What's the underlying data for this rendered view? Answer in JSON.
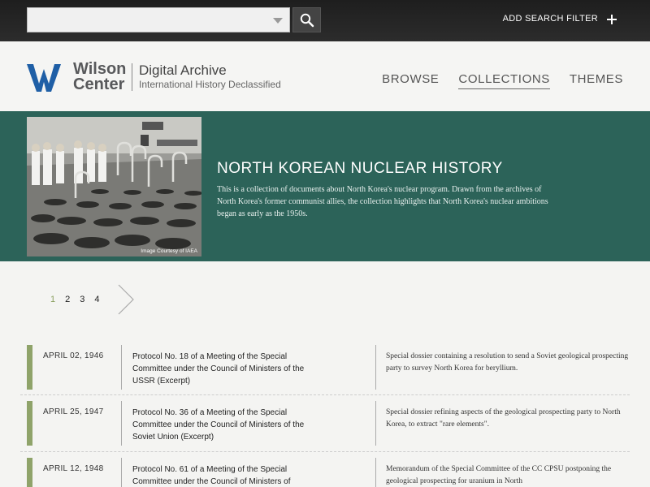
{
  "topbar": {
    "search_placeholder": "",
    "add_filter_label": "ADD SEARCH FILTER"
  },
  "header": {
    "logo_name_line1": "Wilson",
    "logo_name_line2": "Center",
    "site_title": "Digital Archive",
    "site_subtitle": "International History Declassified",
    "nav": [
      {
        "label": "BROWSE"
      },
      {
        "label": "COLLECTIONS"
      },
      {
        "label": "THEMES"
      }
    ]
  },
  "banner": {
    "image_credit": "Image Courtesy of IAEA",
    "title": "NORTH KOREAN NUCLEAR HISTORY",
    "description": "This is a collection of documents about North Korea's nuclear program. Drawn from the archives of North Korea's former communist allies, the collection highlights that North Korea's nuclear ambitions began as early as the 1950s."
  },
  "pagination": {
    "pages": [
      "1",
      "2",
      "3",
      "4"
    ],
    "current": "1"
  },
  "documents": [
    {
      "date": "APRIL 02, 1946",
      "title": "Protocol No. 18 of a Meeting of the Special Committee under the Council of Ministers of the USSR (Excerpt)",
      "description": "Special dossier containing a resolution to send a Soviet geological prospecting party to survey North Korea for beryllium."
    },
    {
      "date": "APRIL 25, 1947",
      "title": "Protocol No. 36 of a Meeting of the Special Committee under the Council of Ministers of the Soviet Union (Excerpt)",
      "description": "Special dossier refining aspects of the geological prospecting party to North Korea, to extract \"rare elements\"."
    },
    {
      "date": "APRIL 12, 1948",
      "title": "Protocol No. 61 of a Meeting of the Special Committee under the Council of Ministers of",
      "description": "Memorandum of the Special Committee of the CC CPSU postponing the geological prospecting for uranium in North"
    }
  ]
}
